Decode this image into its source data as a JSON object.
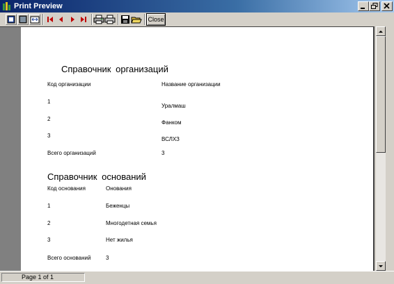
{
  "window": {
    "title": "Print Preview"
  },
  "toolbar": {
    "close_label": "Close"
  },
  "report": {
    "org_title": "Справочник организаций",
    "org_col_code": "Код организации",
    "org_col_name": "Название организации",
    "org_rows": [
      {
        "code": "1",
        "name": "Уралмаш"
      },
      {
        "code": "2",
        "name": "Фанком"
      },
      {
        "code": "3",
        "name": "ВСЛХЗ"
      }
    ],
    "org_total_label": "Всего организаций",
    "org_total_value": "3",
    "base_title": "Справочник оснований",
    "base_col_code": "Код основания",
    "base_col_name": "Онования",
    "base_rows": [
      {
        "code": "1",
        "name": "Беженцы"
      },
      {
        "code": "2",
        "name": "Многодетная семья"
      },
      {
        "code": "3",
        "name": "Нет жилья"
      }
    ],
    "base_total_label": "Всего оснований",
    "base_total_value": "3"
  },
  "status": {
    "page": "Page 1 of 1"
  }
}
